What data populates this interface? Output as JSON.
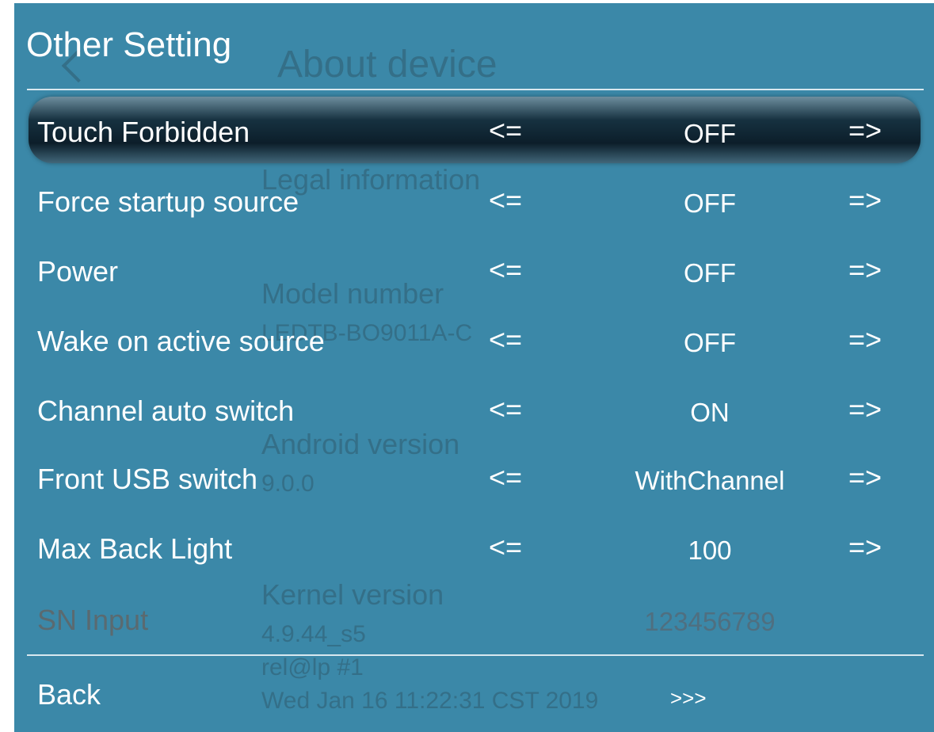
{
  "background_screen": {
    "title": "About device",
    "items": [
      {
        "label": "Legal information"
      },
      {
        "label": "Model number",
        "value": "LEDTB-BO9011A-C"
      },
      {
        "label": "Android version",
        "value": "9.0.0"
      },
      {
        "label": "Kernel version",
        "lines": [
          "4.9.44_s5",
          "rel@lp #1",
          "Wed Jan 16 11:22:31 CST 2019"
        ]
      }
    ]
  },
  "header": {
    "title": "Other Setting"
  },
  "settings": [
    {
      "label": "Touch Forbidden",
      "left_arrow": "<=",
      "value": "OFF",
      "right_arrow": "=>"
    },
    {
      "label": "Force startup source",
      "left_arrow": "<=",
      "value": "OFF",
      "right_arrow": "=>"
    },
    {
      "label": "Power",
      "left_arrow": "<=",
      "value": "OFF",
      "right_arrow": "=>"
    },
    {
      "label": "Wake on active source",
      "left_arrow": "<=",
      "value": "OFF",
      "right_arrow": "=>"
    },
    {
      "label": "Channel auto switch",
      "left_arrow": "<=",
      "value": "ON",
      "right_arrow": "=>"
    },
    {
      "label": "Front USB switch",
      "left_arrow": "<=",
      "value": "WithChannel",
      "right_arrow": "=>"
    },
    {
      "label": "Max Back Light",
      "left_arrow": "<=",
      "value": "100",
      "right_arrow": "=>"
    },
    {
      "label": "SN Input",
      "value": "123456789"
    }
  ],
  "back": {
    "label": "Back",
    "value": ">>>"
  },
  "colors": {
    "panel_bg": "#3b88a8",
    "text": "#ffffff",
    "selected_bar": "#0c1e2a",
    "disabled_text": "#5a6a70"
  },
  "icons": {
    "back_chevron": "chevron-left-icon"
  }
}
